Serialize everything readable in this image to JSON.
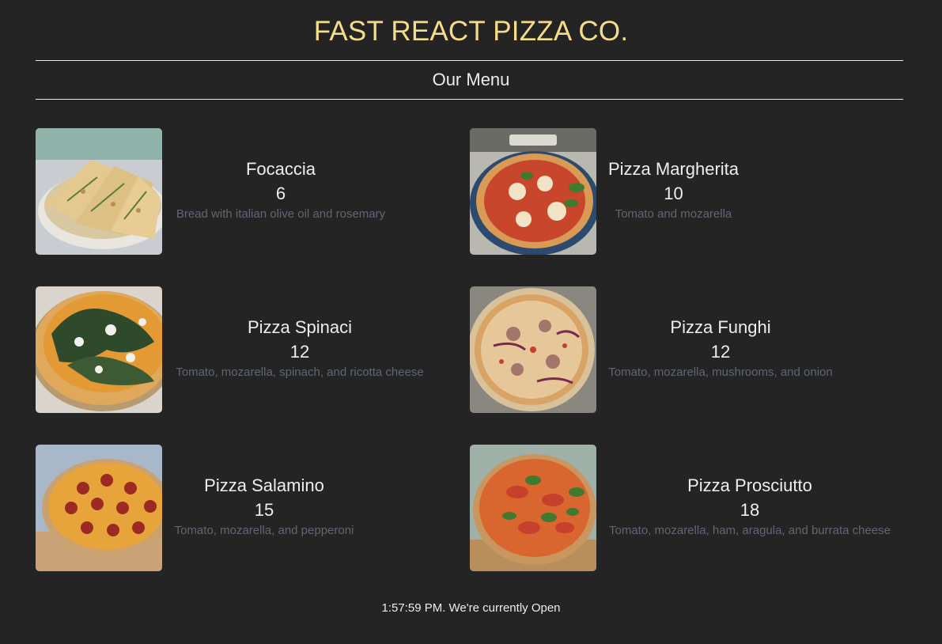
{
  "header": {
    "brand": "FAST REACT PIZZA CO.",
    "section_title": "Our Menu"
  },
  "menu": [
    {
      "name": "Focaccia",
      "price": "6",
      "ingredients": "Bread with italian olive oil and rosemary"
    },
    {
      "name": "Pizza Margherita",
      "price": "10",
      "ingredients": "Tomato and mozarella"
    },
    {
      "name": "Pizza Spinaci",
      "price": "12",
      "ingredients": "Tomato, mozarella, spinach, and ricotta cheese"
    },
    {
      "name": "Pizza Funghi",
      "price": "12",
      "ingredients": "Tomato, mozarella, mushrooms, and onion"
    },
    {
      "name": "Pizza Salamino",
      "price": "15",
      "ingredients": "Tomato, mozarella, and pepperoni"
    },
    {
      "name": "Pizza Prosciutto",
      "price": "18",
      "ingredients": "Tomato, mozarella, ham, aragula, and burrata cheese"
    }
  ],
  "footer": {
    "status": "1:57:59 PM. We're currently Open"
  },
  "colors": {
    "background": "#242424",
    "brand": "#f4dc8a",
    "text": "#e6e6e6",
    "ingredients": "#5f6773"
  }
}
